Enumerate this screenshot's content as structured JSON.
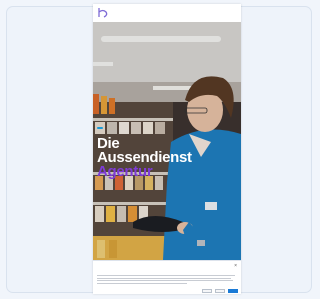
{
  "header": {
    "logo_text": "",
    "nav": [
      "",
      "",
      "",
      ""
    ]
  },
  "hero": {
    "badge": "",
    "title_line1": "Die",
    "title_line2": "Aussendienst",
    "title_line3": "Agentur"
  },
  "consent": {
    "title": "",
    "subtitle": "",
    "close": "×",
    "buttons": [
      "",
      "",
      ""
    ]
  },
  "colors": {
    "accent": "#1a9ad6",
    "purple": "#7e3bd6",
    "shirt": "#1f7fc2",
    "brand": "#2c6fbf"
  }
}
